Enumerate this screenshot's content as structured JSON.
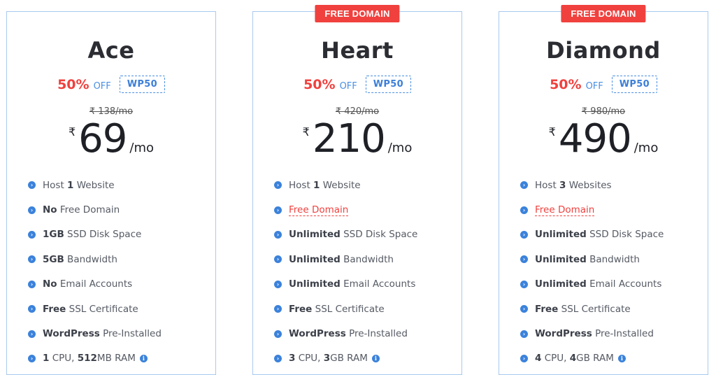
{
  "plans": [
    {
      "ribbon": "",
      "name": "Ace",
      "discount_pct": "50%",
      "discount_off": "OFF",
      "coupon": "WP50",
      "old_price": "₹ 138/mo",
      "currency": "₹",
      "price": "69",
      "per": "/mo",
      "features": [
        {
          "bold": "",
          "text": "Host ",
          "bold2": "1",
          "text2": " Website"
        },
        {
          "bold": "No",
          "text": " Free Domain"
        },
        {
          "bold": "1GB",
          "text": " SSD Disk Space"
        },
        {
          "bold": "5GB",
          "text": " Bandwidth"
        },
        {
          "bold": "No",
          "text": " Email Accounts"
        },
        {
          "bold": "Free",
          "text": " SSL Certificate"
        },
        {
          "bold": "WordPress",
          "text": " Pre-Installed"
        },
        {
          "bold": "1",
          "text": " CPU, ",
          "bold2": "512",
          "text2": "MB RAM"
        }
      ]
    },
    {
      "ribbon": "FREE DOMAIN",
      "name": "Heart",
      "discount_pct": "50%",
      "discount_off": "OFF",
      "coupon": "WP50",
      "old_price": "₹ 420/mo",
      "currency": "₹",
      "price": "210",
      "per": "/mo",
      "features": [
        {
          "bold": "",
          "text": "Host ",
          "bold2": "1",
          "text2": " Website"
        },
        {
          "red": "Free Domain"
        },
        {
          "bold": "Unlimited",
          "text": " SSD Disk Space"
        },
        {
          "bold": "Unlimited",
          "text": " Bandwidth"
        },
        {
          "bold": "Unlimited",
          "text": " Email Accounts"
        },
        {
          "bold": "Free",
          "text": " SSL Certificate"
        },
        {
          "bold": "WordPress",
          "text": " Pre-Installed"
        },
        {
          "bold": "3",
          "text": " CPU, ",
          "bold2": "3",
          "text2": "GB RAM"
        }
      ]
    },
    {
      "ribbon": "FREE DOMAIN",
      "name": "Diamond",
      "discount_pct": "50%",
      "discount_off": "OFF",
      "coupon": "WP50",
      "old_price": "₹ 980/mo",
      "currency": "₹",
      "price": "490",
      "per": "/mo",
      "features": [
        {
          "bold": "",
          "text": "Host ",
          "bold2": "3",
          "text2": " Websites"
        },
        {
          "red": "Free Domain"
        },
        {
          "bold": "Unlimited",
          "text": " SSD Disk Space"
        },
        {
          "bold": "Unlimited",
          "text": " Bandwidth"
        },
        {
          "bold": "Unlimited",
          "text": " Email Accounts"
        },
        {
          "bold": "Free",
          "text": " SSL Certificate"
        },
        {
          "bold": "WordPress",
          "text": " Pre-Installed"
        },
        {
          "bold": "4",
          "text": " CPU, ",
          "bold2": "4",
          "text2": "GB RAM"
        }
      ]
    }
  ],
  "icons": {
    "bullet": "chevron-circle-right-icon",
    "info": "info-circle-icon"
  },
  "colors": {
    "accent_red": "#f0413e",
    "accent_blue": "#3b82db",
    "card_border": "#a9c9ef"
  }
}
